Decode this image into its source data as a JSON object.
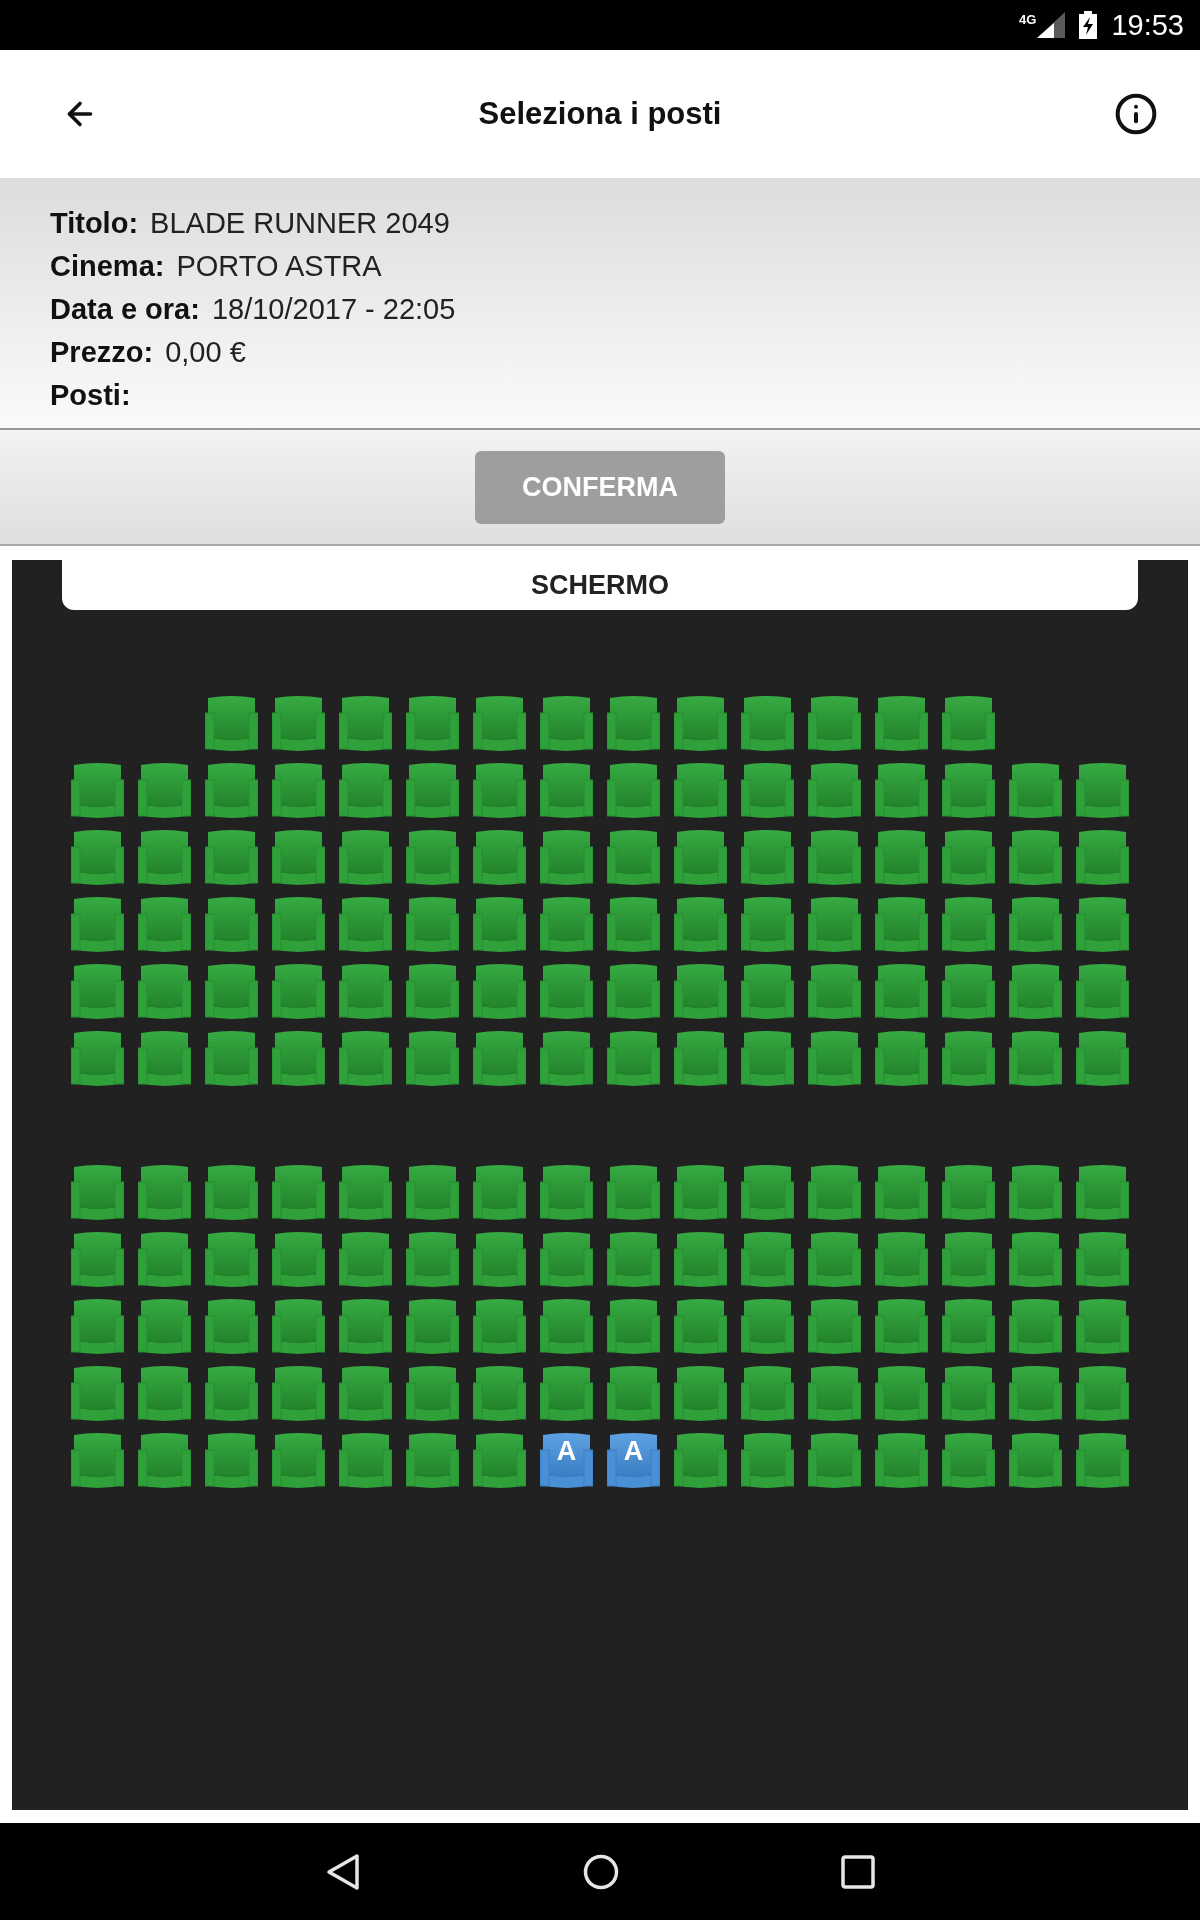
{
  "status_bar": {
    "network": "4G",
    "time": "19:53"
  },
  "header": {
    "title": "Seleziona i posti"
  },
  "details": [
    {
      "label": "Titolo:",
      "value": "BLADE RUNNER 2049"
    },
    {
      "label": "Cinema:",
      "value": "PORTO ASTRA"
    },
    {
      "label": "Data e ora:",
      "value": "18/10/2017 - 22:05"
    },
    {
      "label": "Prezzo:",
      "value": "0,00 €"
    },
    {
      "label": "Posti:"
    }
  ],
  "confirm_button": {
    "label": "CONFERMA",
    "disabled": true
  },
  "screen_label": "SCHERMO",
  "sections": [
    {
      "rows": [
        {
          "seats": [
            {
              "kind": "empty"
            },
            {
              "kind": "empty"
            },
            {
              "kind": "seat",
              "selected": false
            },
            {
              "kind": "seat",
              "selected": false
            },
            {
              "kind": "seat",
              "selected": false
            },
            {
              "kind": "seat",
              "selected": false
            },
            {
              "kind": "seat",
              "selected": false
            },
            {
              "kind": "seat",
              "selected": false
            },
            {
              "kind": "seat",
              "selected": false
            },
            {
              "kind": "seat",
              "selected": false
            },
            {
              "kind": "seat",
              "selected": false
            },
            {
              "kind": "seat",
              "selected": false
            },
            {
              "kind": "seat",
              "selected": false
            },
            {
              "kind": "seat",
              "selected": false
            },
            {
              "kind": "empty"
            },
            {
              "kind": "empty"
            }
          ]
        },
        {
          "seats": [
            {
              "kind": "seat",
              "selected": false
            },
            {
              "kind": "seat",
              "selected": false
            },
            {
              "kind": "seat",
              "selected": false
            },
            {
              "kind": "seat",
              "selected": false
            },
            {
              "kind": "seat",
              "selected": false
            },
            {
              "kind": "seat",
              "selected": false
            },
            {
              "kind": "seat",
              "selected": false
            },
            {
              "kind": "seat",
              "selected": false
            },
            {
              "kind": "seat",
              "selected": false
            },
            {
              "kind": "seat",
              "selected": false
            },
            {
              "kind": "seat",
              "selected": false
            },
            {
              "kind": "seat",
              "selected": false
            },
            {
              "kind": "seat",
              "selected": false
            },
            {
              "kind": "seat",
              "selected": false
            },
            {
              "kind": "seat",
              "selected": false
            },
            {
              "kind": "seat",
              "selected": false
            }
          ]
        },
        {
          "seats": [
            {
              "kind": "seat",
              "selected": false
            },
            {
              "kind": "seat",
              "selected": false
            },
            {
              "kind": "seat",
              "selected": false
            },
            {
              "kind": "seat",
              "selected": false
            },
            {
              "kind": "seat",
              "selected": false
            },
            {
              "kind": "seat",
              "selected": false
            },
            {
              "kind": "seat",
              "selected": false
            },
            {
              "kind": "seat",
              "selected": false
            },
            {
              "kind": "seat",
              "selected": false
            },
            {
              "kind": "seat",
              "selected": false
            },
            {
              "kind": "seat",
              "selected": false
            },
            {
              "kind": "seat",
              "selected": false
            },
            {
              "kind": "seat",
              "selected": false
            },
            {
              "kind": "seat",
              "selected": false
            },
            {
              "kind": "seat",
              "selected": false
            },
            {
              "kind": "seat",
              "selected": false
            }
          ]
        },
        {
          "seats": [
            {
              "kind": "seat",
              "selected": false
            },
            {
              "kind": "seat",
              "selected": false
            },
            {
              "kind": "seat",
              "selected": false
            },
            {
              "kind": "seat",
              "selected": false
            },
            {
              "kind": "seat",
              "selected": false
            },
            {
              "kind": "seat",
              "selected": false
            },
            {
              "kind": "seat",
              "selected": false
            },
            {
              "kind": "seat",
              "selected": false
            },
            {
              "kind": "seat",
              "selected": false
            },
            {
              "kind": "seat",
              "selected": false
            },
            {
              "kind": "seat",
              "selected": false
            },
            {
              "kind": "seat",
              "selected": false
            },
            {
              "kind": "seat",
              "selected": false
            },
            {
              "kind": "seat",
              "selected": false
            },
            {
              "kind": "seat",
              "selected": false
            },
            {
              "kind": "seat",
              "selected": false
            }
          ]
        },
        {
          "seats": [
            {
              "kind": "seat",
              "selected": false
            },
            {
              "kind": "seat",
              "selected": false
            },
            {
              "kind": "seat",
              "selected": false
            },
            {
              "kind": "seat",
              "selected": false
            },
            {
              "kind": "seat",
              "selected": false
            },
            {
              "kind": "seat",
              "selected": false
            },
            {
              "kind": "seat",
              "selected": false
            },
            {
              "kind": "seat",
              "selected": false
            },
            {
              "kind": "seat",
              "selected": false
            },
            {
              "kind": "seat",
              "selected": false
            },
            {
              "kind": "seat",
              "selected": false
            },
            {
              "kind": "seat",
              "selected": false
            },
            {
              "kind": "seat",
              "selected": false
            },
            {
              "kind": "seat",
              "selected": false
            },
            {
              "kind": "seat",
              "selected": false
            },
            {
              "kind": "seat",
              "selected": false
            }
          ]
        },
        {
          "seats": [
            {
              "kind": "seat",
              "selected": false
            },
            {
              "kind": "seat",
              "selected": false
            },
            {
              "kind": "seat",
              "selected": false
            },
            {
              "kind": "seat",
              "selected": false
            },
            {
              "kind": "seat",
              "selected": false
            },
            {
              "kind": "seat",
              "selected": false
            },
            {
              "kind": "seat",
              "selected": false
            },
            {
              "kind": "seat",
              "selected": false
            },
            {
              "kind": "seat",
              "selected": false
            },
            {
              "kind": "seat",
              "selected": false
            },
            {
              "kind": "seat",
              "selected": false
            },
            {
              "kind": "seat",
              "selected": false
            },
            {
              "kind": "seat",
              "selected": false
            },
            {
              "kind": "seat",
              "selected": false
            },
            {
              "kind": "seat",
              "selected": false
            },
            {
              "kind": "seat",
              "selected": false
            }
          ]
        }
      ]
    },
    {
      "rows": [
        {
          "seats": [
            {
              "kind": "seat",
              "selected": false
            },
            {
              "kind": "seat",
              "selected": false
            },
            {
              "kind": "seat",
              "selected": false
            },
            {
              "kind": "seat",
              "selected": false
            },
            {
              "kind": "seat",
              "selected": false
            },
            {
              "kind": "seat",
              "selected": false
            },
            {
              "kind": "seat",
              "selected": false
            },
            {
              "kind": "seat",
              "selected": false
            },
            {
              "kind": "seat",
              "selected": false
            },
            {
              "kind": "seat",
              "selected": false
            },
            {
              "kind": "seat",
              "selected": false
            },
            {
              "kind": "seat",
              "selected": false
            },
            {
              "kind": "seat",
              "selected": false
            },
            {
              "kind": "seat",
              "selected": false
            },
            {
              "kind": "seat",
              "selected": false
            },
            {
              "kind": "seat",
              "selected": false
            }
          ]
        },
        {
          "seats": [
            {
              "kind": "seat",
              "selected": false
            },
            {
              "kind": "seat",
              "selected": false
            },
            {
              "kind": "seat",
              "selected": false
            },
            {
              "kind": "seat",
              "selected": false
            },
            {
              "kind": "seat",
              "selected": false
            },
            {
              "kind": "seat",
              "selected": false
            },
            {
              "kind": "seat",
              "selected": false
            },
            {
              "kind": "seat",
              "selected": false
            },
            {
              "kind": "seat",
              "selected": false
            },
            {
              "kind": "seat",
              "selected": false
            },
            {
              "kind": "seat",
              "selected": false
            },
            {
              "kind": "seat",
              "selected": false
            },
            {
              "kind": "seat",
              "selected": false
            },
            {
              "kind": "seat",
              "selected": false
            },
            {
              "kind": "seat",
              "selected": false
            },
            {
              "kind": "seat",
              "selected": false
            }
          ]
        },
        {
          "seats": [
            {
              "kind": "seat",
              "selected": false
            },
            {
              "kind": "seat",
              "selected": false
            },
            {
              "kind": "seat",
              "selected": false
            },
            {
              "kind": "seat",
              "selected": false
            },
            {
              "kind": "seat",
              "selected": false
            },
            {
              "kind": "seat",
              "selected": false
            },
            {
              "kind": "seat",
              "selected": false
            },
            {
              "kind": "seat",
              "selected": false
            },
            {
              "kind": "seat",
              "selected": false
            },
            {
              "kind": "seat",
              "selected": false
            },
            {
              "kind": "seat",
              "selected": false
            },
            {
              "kind": "seat",
              "selected": false
            },
            {
              "kind": "seat",
              "selected": false
            },
            {
              "kind": "seat",
              "selected": false
            },
            {
              "kind": "seat",
              "selected": false
            },
            {
              "kind": "seat",
              "selected": false
            }
          ]
        },
        {
          "seats": [
            {
              "kind": "seat",
              "selected": false
            },
            {
              "kind": "seat",
              "selected": false
            },
            {
              "kind": "seat",
              "selected": false
            },
            {
              "kind": "seat",
              "selected": false
            },
            {
              "kind": "seat",
              "selected": false
            },
            {
              "kind": "seat",
              "selected": false
            },
            {
              "kind": "seat",
              "selected": false
            },
            {
              "kind": "seat",
              "selected": false
            },
            {
              "kind": "seat",
              "selected": false
            },
            {
              "kind": "seat",
              "selected": false
            },
            {
              "kind": "seat",
              "selected": false
            },
            {
              "kind": "seat",
              "selected": false
            },
            {
              "kind": "seat",
              "selected": false
            },
            {
              "kind": "seat",
              "selected": false
            },
            {
              "kind": "seat",
              "selected": false
            },
            {
              "kind": "seat",
              "selected": false
            }
          ]
        },
        {
          "seats": [
            {
              "kind": "seat",
              "selected": false
            },
            {
              "kind": "seat",
              "selected": false
            },
            {
              "kind": "seat",
              "selected": false
            },
            {
              "kind": "seat",
              "selected": false
            },
            {
              "kind": "seat",
              "selected": false
            },
            {
              "kind": "seat",
              "selected": false
            },
            {
              "kind": "seat",
              "selected": false
            },
            {
              "kind": "seat",
              "selected": true,
              "label": "A"
            },
            {
              "kind": "seat",
              "selected": true,
              "label": "A"
            },
            {
              "kind": "seat",
              "selected": false
            },
            {
              "kind": "seat",
              "selected": false
            },
            {
              "kind": "seat",
              "selected": false
            },
            {
              "kind": "seat",
              "selected": false
            },
            {
              "kind": "seat",
              "selected": false
            },
            {
              "kind": "seat",
              "selected": false
            },
            {
              "kind": "seat",
              "selected": false
            }
          ]
        }
      ]
    }
  ]
}
